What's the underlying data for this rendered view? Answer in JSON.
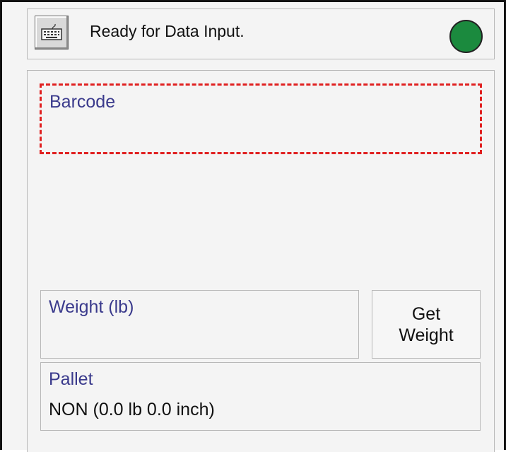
{
  "status_bar": {
    "keyboard_icon": "keyboard-icon",
    "message": "Ready for Data Input.",
    "indicator_color": "#1b8a3e"
  },
  "barcode_field": {
    "label": "Barcode",
    "value": "",
    "highlight_color": "#e02020"
  },
  "weight_field": {
    "label": "Weight (lb)",
    "value": ""
  },
  "get_weight_button": {
    "label": "Get\nWeight"
  },
  "pallet_field": {
    "label": "Pallet",
    "value": "NON (0.0 lb 0.0 inch)"
  },
  "colors": {
    "label_text": "#3a3a8c",
    "status_ready": "#1b8a3e",
    "focus_border": "#e02020"
  }
}
